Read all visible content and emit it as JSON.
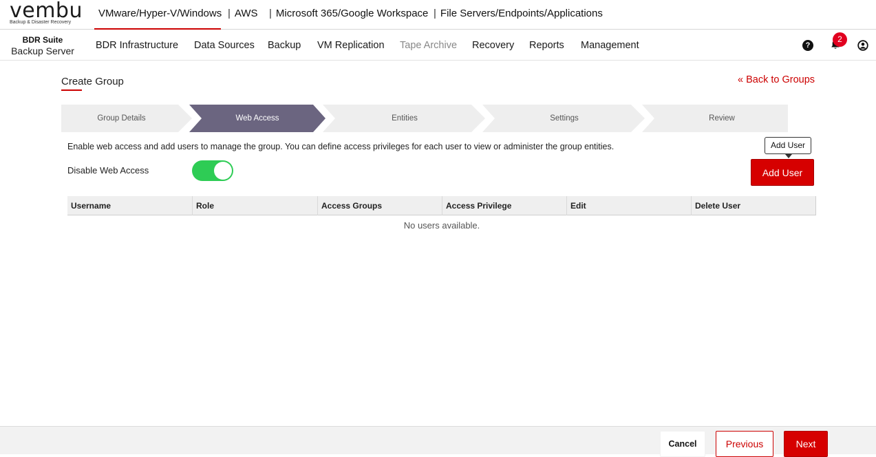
{
  "brand": {
    "logo_word": "vembu",
    "logo_tagline": "Backup & Disaster Recovery",
    "suite_name": "BDR Suite",
    "server_name": "Backup Server",
    "accent_color": "#d60000"
  },
  "product_tabs": [
    {
      "label": "VMware/Hyper-V/Windows",
      "active": true
    },
    {
      "label": "AWS",
      "active": false
    },
    {
      "label": "Microsoft 365/Google Workspace",
      "active": false
    },
    {
      "label": "File Servers/Endpoints/Applications",
      "active": false
    }
  ],
  "product_tab_separator": "|",
  "nav": [
    {
      "label": "BDR Infrastructure"
    },
    {
      "label": "Data Sources"
    },
    {
      "label": "Backup"
    },
    {
      "label": "VM Replication"
    },
    {
      "label": "Tape Archive",
      "disabled": true
    },
    {
      "label": "Recovery"
    },
    {
      "label": "Reports"
    },
    {
      "label": "Management"
    }
  ],
  "header_icons": {
    "help": "question-circle-icon",
    "help_glyph": "?",
    "notifications": "bell-icon",
    "notification_count": "2",
    "user": "user-circle-icon"
  },
  "page": {
    "title": "Create Group",
    "back_link": "« Back to Groups"
  },
  "steps": [
    {
      "label": "Group Details",
      "active": false
    },
    {
      "label": "Web Access",
      "active": true
    },
    {
      "label": "Entities",
      "active": false
    },
    {
      "label": "Settings",
      "active": false
    },
    {
      "label": "Review",
      "active": false
    }
  ],
  "web_access": {
    "description": "Enable web access and add users to manage the group. You can define access privileges for each user to view or administer the group entities.",
    "toggle_label": "Disable Web Access",
    "toggle_on": true,
    "tooltip": "Add User",
    "add_user_label": "Add User"
  },
  "table": {
    "columns": [
      "Username",
      "Role",
      "Access Groups",
      "Access Privilege",
      "Edit",
      "Delete User"
    ],
    "rows": [],
    "empty_message": "No users available."
  },
  "footer": {
    "cancel_label": "Cancel",
    "previous_label": "Previous",
    "next_label": "Next"
  }
}
